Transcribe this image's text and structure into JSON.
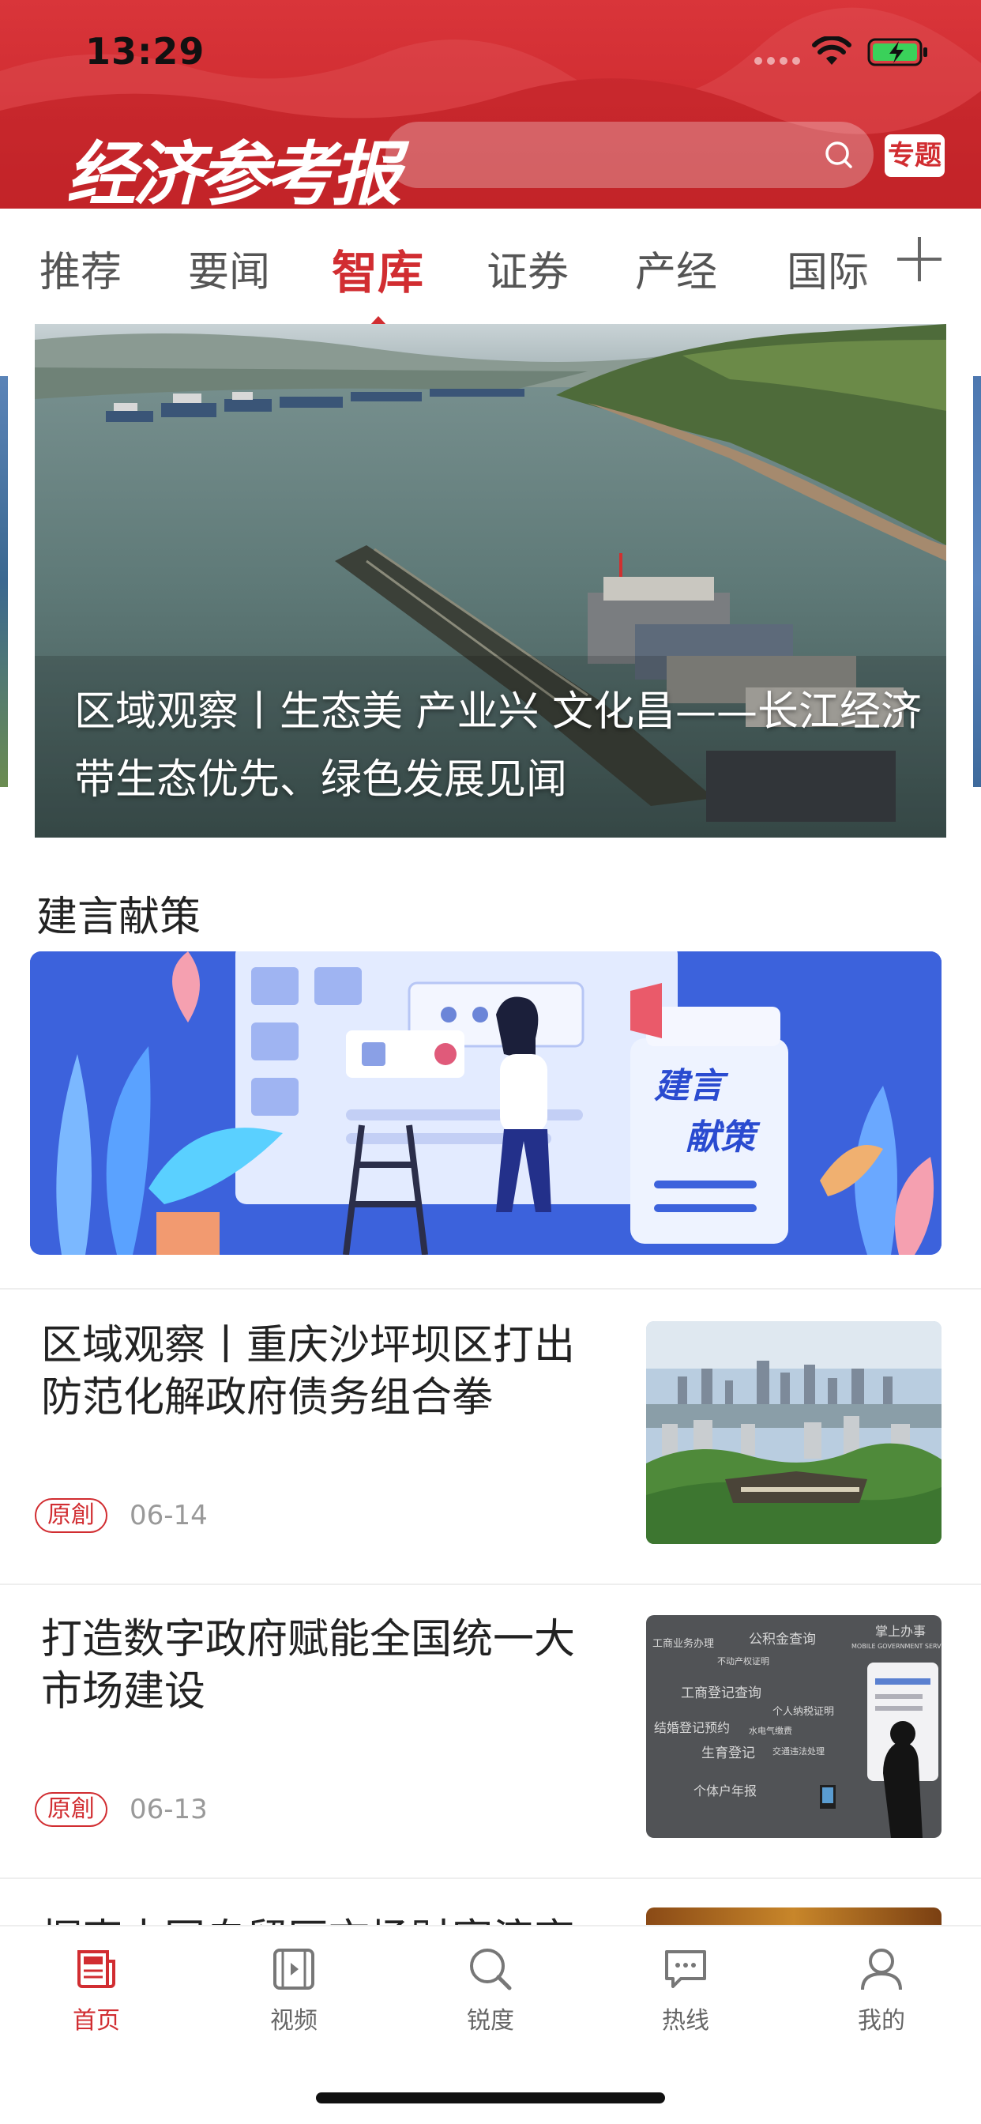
{
  "status_bar": {
    "time": "13:29"
  },
  "header": {
    "logo": "经济参考报",
    "search_placeholder": "",
    "topic_button": "专题"
  },
  "tabs": [
    {
      "label": "推荐",
      "active": false
    },
    {
      "label": "要闻",
      "active": false
    },
    {
      "label": "智库",
      "active": true
    },
    {
      "label": "证券",
      "active": false
    },
    {
      "label": "产经",
      "active": false
    },
    {
      "label": "国际",
      "active": false
    }
  ],
  "hero": {
    "title": "区域观察丨生态美 产业兴 文化昌——长江经济带生态优先、绿色发展见闻"
  },
  "section": {
    "title": "建言献策",
    "banner_text_1": "建言",
    "banner_text_2": "献策"
  },
  "articles": [
    {
      "title": "区域观察丨重庆沙坪坝区打出防范化解政府债务组合拳",
      "badge": "原創",
      "date": "06-14"
    },
    {
      "title": "打造数字政府赋能全国统一大市场建设",
      "badge": "原創",
      "date": "06-13",
      "thumb_header": "掌上办事",
      "thumb_sub": "MOBILE GOVERNMENT SERVICE APP",
      "thumb_words": [
        "工商业务办理",
        "公积金查询",
        "不动产权证明",
        "工商登记查询",
        "个人纳税证明",
        "结婚登记预约",
        "水电气缴费",
        "生育登记",
        "交通违法处理",
        "个体户年报"
      ]
    }
  ],
  "peek_article": {
    "title": "探索中国自贸区市场财富演变"
  },
  "bottom_nav": [
    {
      "label": "首页",
      "icon": "news-icon",
      "active": true
    },
    {
      "label": "视频",
      "icon": "video-icon",
      "active": false
    },
    {
      "label": "锐度",
      "icon": "search-icon",
      "active": false
    },
    {
      "label": "热线",
      "icon": "chat-icon",
      "active": false
    },
    {
      "label": "我的",
      "icon": "user-icon",
      "active": false
    }
  ],
  "colors": {
    "brand_red": "#d12d31",
    "header_red": "#cf2b30",
    "banner_blue": "#3a5fd6"
  }
}
